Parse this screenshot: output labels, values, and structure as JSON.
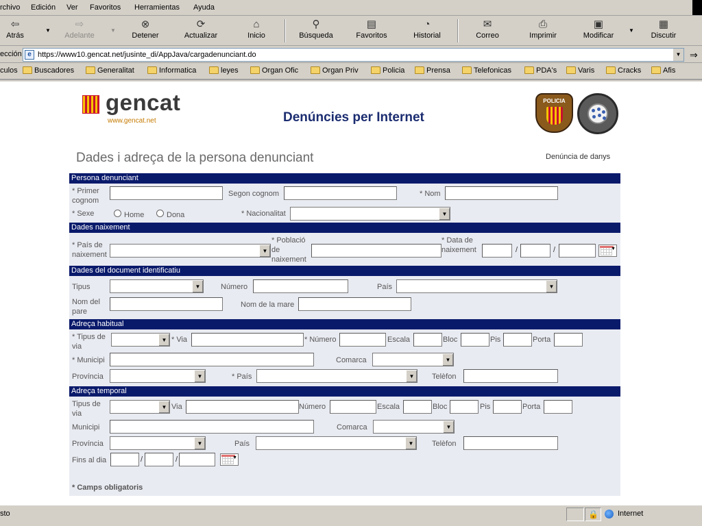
{
  "browser": {
    "menu": [
      "rchivo",
      "Edición",
      "Ver",
      "Favoritos",
      "Herramientas",
      "Ayuda"
    ],
    "toolbar": {
      "back": "Atrás",
      "forward": "Adelante",
      "stop": "Detener",
      "refresh": "Actualizar",
      "home": "Inicio",
      "search": "Búsqueda",
      "favorites": "Favoritos",
      "history": "Historial",
      "mail": "Correo",
      "print": "Imprimir",
      "edit": "Modificar",
      "discuss": "Discutir"
    },
    "address_label": "ección",
    "url": "https://www10.gencat.net/jusinte_di/AppJava/cargadenunciant.do",
    "links_label": "culos",
    "links": [
      "Buscadores",
      "Generalitat",
      "Informatica",
      "leyes",
      "Organ Ofic",
      "Organ Priv",
      "Policia",
      "Prensa",
      "Telefonicas",
      "PDA's",
      "Varis",
      "Cracks",
      "Afis"
    ],
    "status_text": "sto",
    "zone": "Internet"
  },
  "page": {
    "logo_word": "gencat",
    "logo_url": "www.gencat.net",
    "title": "Denúncies per Internet",
    "police_badge": "POLICIA",
    "heading": "Dades i adreça de la persona denunciant",
    "denuncia_type": "Denúncia de danys",
    "required_note": "* Camps obligatoris"
  },
  "sections": {
    "persona": "Persona denunciant",
    "naixement": "Dades naixement",
    "document": "Dades del document identificatiu",
    "habitual": "Adreça habitual",
    "temporal": "Adreça temporal"
  },
  "labels": {
    "primer_cognom": "* Primer cognom",
    "segon_cognom": "Segon cognom",
    "nom": "* Nom",
    "sexe": "* Sexe",
    "home": "Home",
    "dona": "Dona",
    "nacionalitat": "* Nacionalitat",
    "pais_naixement": "* País de naixement",
    "poblacio_naixement": "* Població de naixement",
    "data_naixement": "* Data de naixement",
    "tipus": "Tipus",
    "numero": "Número",
    "pais": "País",
    "nom_pare": "Nom del pare",
    "nom_mare": "Nom de la mare",
    "tipus_via_req": "* Tipus de via",
    "via_req": "* Via",
    "numero_req": "* Número",
    "escala": "Escala",
    "bloc": "Bloc",
    "pis": "Pis",
    "porta": "Porta",
    "municipi_req": "* Municipi",
    "comarca": "Comarca",
    "provincia": "Província",
    "pais_req": "* País",
    "telefon": "Telèfon",
    "tipus_via": "Tipus de via",
    "via": "Via",
    "municipi": "Municipi",
    "fins_al_dia": "Fins al dia"
  }
}
